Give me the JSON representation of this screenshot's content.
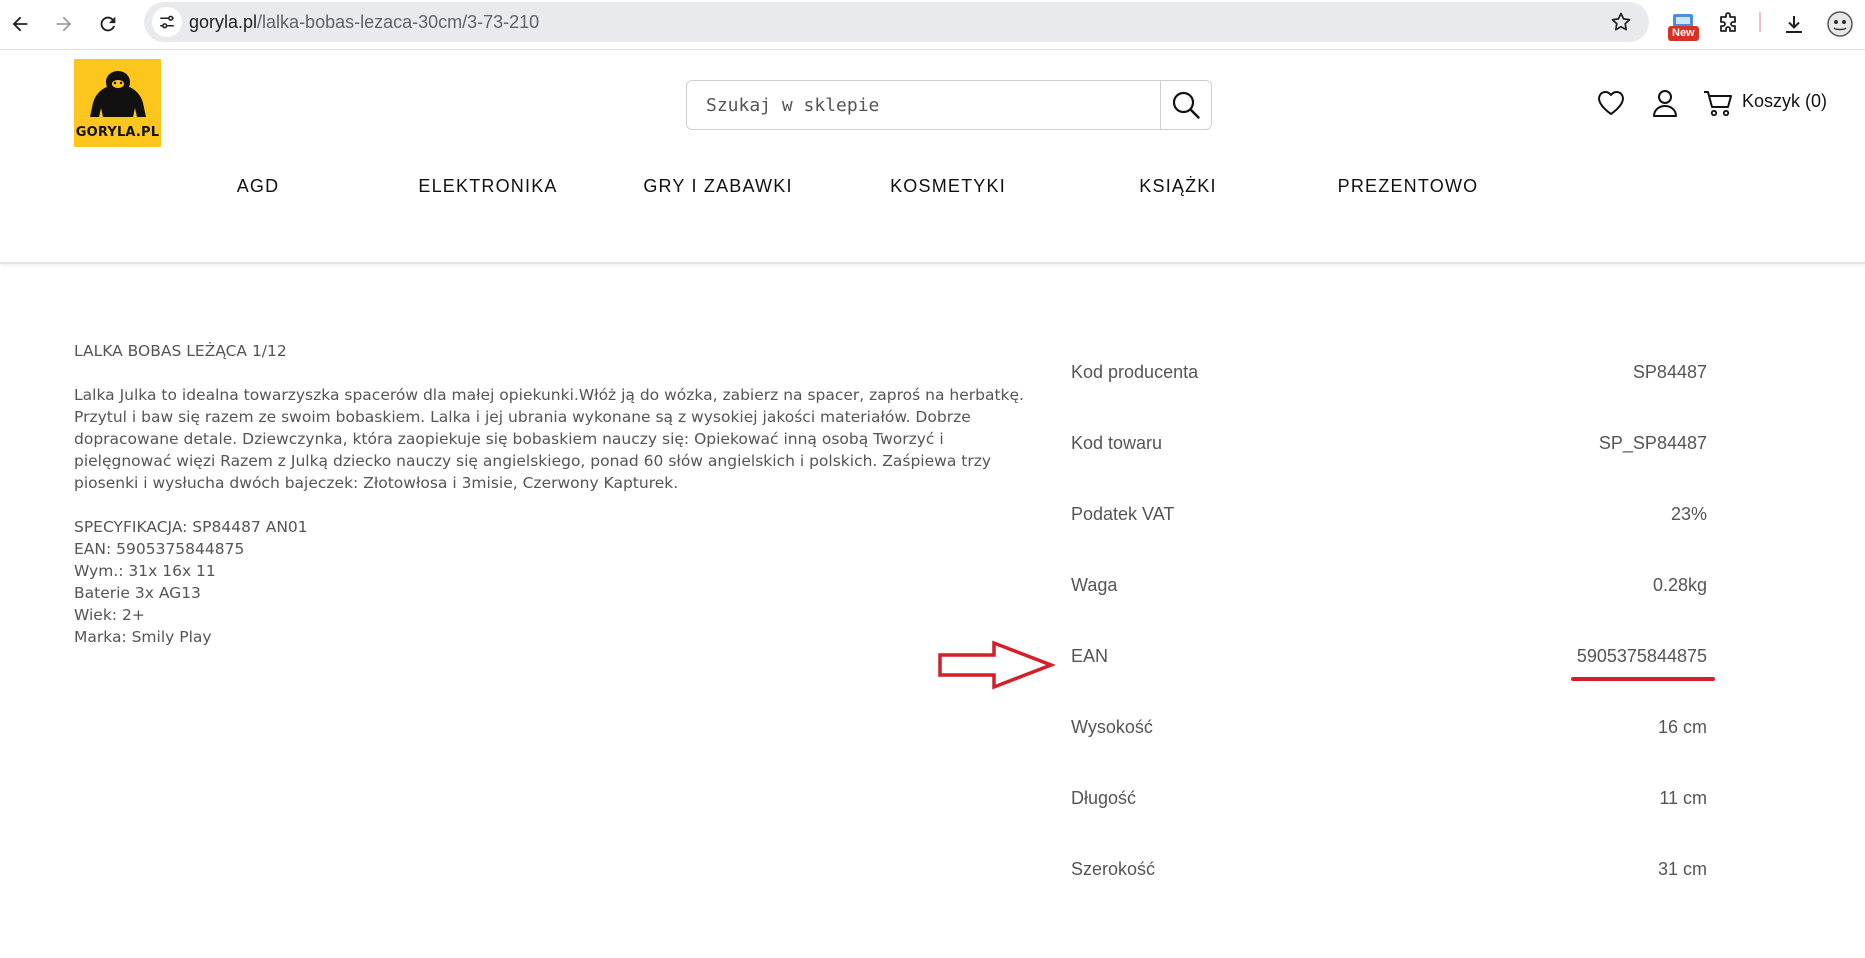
{
  "browser": {
    "url_domain": "goryla.pl",
    "url_path": "/lalka-bobas-lezaca-30cm/3-73-210",
    "new_badge": "New"
  },
  "header": {
    "logo_text": "GORYLA.PL",
    "search_placeholder": "Szukaj w sklepie",
    "cart_label": "Koszyk (0)"
  },
  "categories": [
    "AGD",
    "ELEKTRONIKA",
    "GRY I ZABAWKI",
    "KOSMETYKI",
    "KSIĄŻKI",
    "PREZENTOWO"
  ],
  "description": {
    "title": "LALKA BOBAS LEŻĄCA 1/12",
    "body": "Lalka Julka to idealna towarzyszka spacerów dla małej opiekunki.Włóż ją do wózka, zabierz na spacer, zaproś na herbatkę. Przytul i baw się razem ze swoim bobaskiem. Lalka i jej ubrania wykonane są z wysokiej jakości materiałów. Dobrze dopracowane detale. Dziewczynka, która zaopiekuje się bobaskiem nauczy się: Opiekować inną osobą Tworzyć i pielęgnować więzi Razem z Julką dziecko nauczy się angielskiego, ponad 60 słów angielskich i polskich. Zaśpiewa trzy piosenki i wysłucha dwóch bajeczek: Złotowłosa i 3misie, Czerwony Kapturek.",
    "spec_lines": [
      "SPECYFIKACJA: SP84487 AN01",
      "EAN: 5905375844875",
      "Wym.: 31x 16x 11",
      "Baterie 3x AG13",
      "Wiek: 2+",
      "Marka: Smily Play"
    ]
  },
  "specs": [
    {
      "label": "Kod producenta",
      "value": "SP84487"
    },
    {
      "label": "Kod towaru",
      "value": "SP_SP84487"
    },
    {
      "label": "Podatek VAT",
      "value": "23%"
    },
    {
      "label": "Waga",
      "value": "0.28kg"
    },
    {
      "label": "EAN",
      "value": "5905375844875"
    },
    {
      "label": "Wysokość",
      "value": "16 cm"
    },
    {
      "label": "Długość",
      "value": "11 cm"
    },
    {
      "label": "Szerokość",
      "value": "31 cm"
    }
  ],
  "colors": {
    "logo_bg": "#fcc61d",
    "annotation_red": "#d21f2a"
  }
}
